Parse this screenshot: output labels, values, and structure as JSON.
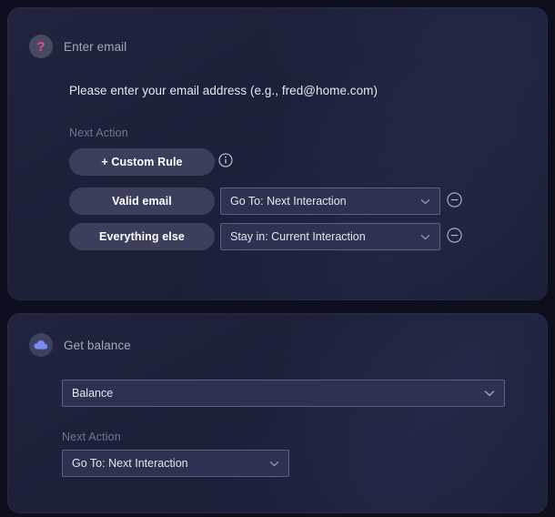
{
  "cards": [
    {
      "id": "enter-email",
      "icon": "question-mark-icon",
      "title": "Enter email",
      "description": "Please enter your email address (e.g., fred@home.com)",
      "next_action_label": "Next Action",
      "custom_rule_button": "+ Custom Rule",
      "info_icon": "info-icon",
      "rules": [
        {
          "condition": "Valid email",
          "action": "Go To: Next Interaction",
          "remove_icon": "minus-circle-icon"
        },
        {
          "condition": "Everything else",
          "action": "Stay in: Current Interaction",
          "remove_icon": "minus-circle-icon"
        }
      ]
    },
    {
      "id": "get-balance",
      "icon": "cloud-icon",
      "title": "Get balance",
      "value_select": "Balance",
      "next_action_label": "Next Action",
      "next_action_select": "Go To: Next Interaction"
    }
  ],
  "colors": {
    "page_background": "#0d0f1c",
    "card_background": "#1c2039",
    "pill_background": "#3b3f5c",
    "select_background": "#2e3252",
    "select_border": "#5d6285",
    "accent_pink": "#f0468f",
    "accent_blue": "#7b8cf0",
    "text_primary": "#e6e8f2",
    "text_muted": "#6f7491",
    "title_text": "#a2a7bd"
  }
}
